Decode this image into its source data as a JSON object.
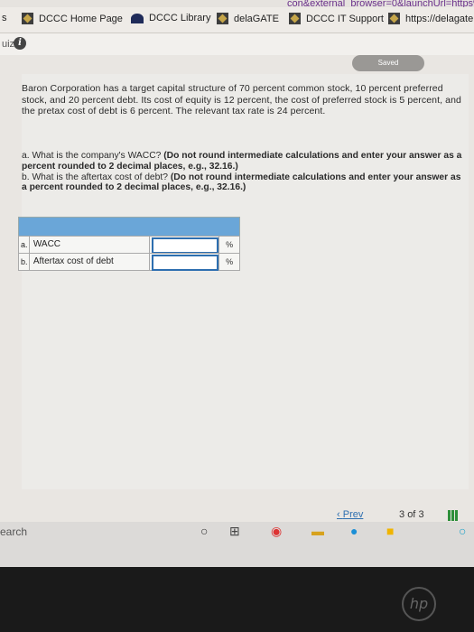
{
  "browser": {
    "url_fragment": "con&external_browser=0&launchUrl=https%",
    "bookmarks": [
      {
        "label": "DCCC Home Page",
        "icon": "dccc-icon"
      },
      {
        "label": "DCCC Library",
        "icon": "library-icon"
      },
      {
        "label": "delaGATE",
        "icon": "dccc-icon"
      },
      {
        "label": "DCCC IT Support",
        "icon": "dccc-icon"
      },
      {
        "label": "https://delagate.d",
        "icon": "dccc-icon"
      }
    ],
    "bookmark_prefix": "s"
  },
  "quiz": {
    "label": "uiz",
    "saved": "Saved"
  },
  "question": {
    "intro": "Baron Corporation has a target capital structure of 70 percent common stock, 10 percent preferred stock, and 20 percent debt. Its cost of equity is 12 percent, the cost of preferred stock is 5 percent, and the pretax cost of debt is 6 percent. The relevant tax rate is 24 percent.",
    "a_lead": "a. What is the company's WACC?",
    "a_note": "(Do not round intermediate calculations and enter your answer as a percent rounded to 2 decimal places, e.g., 32.16.)",
    "b_lead": "b. What is the aftertax cost of debt?",
    "b_note": "(Do not round intermediate calculations and enter your answer as a percent rounded to 2 decimal places, e.g., 32.16.)"
  },
  "answers": [
    {
      "letter": "a.",
      "label": "WACC",
      "value": "",
      "unit": "%"
    },
    {
      "letter": "b.",
      "label": "Aftertax cost of debt",
      "value": "",
      "unit": "%"
    }
  ],
  "pagination": {
    "prev": "Prev",
    "current": "3",
    "of": "of",
    "total": "3"
  },
  "taskbar": {
    "search": "earch"
  },
  "laptop": {
    "brand": "hp"
  }
}
